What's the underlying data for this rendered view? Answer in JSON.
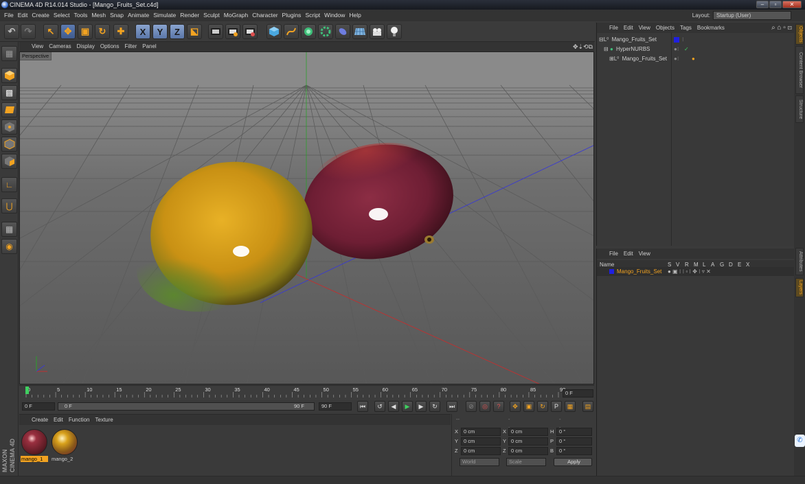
{
  "window": {
    "title": "CINEMA 4D R14.014 Studio - [Mango_Fruits_Set.c4d]",
    "min": "‒",
    "max": "▫",
    "close": "✕"
  },
  "menu": [
    "File",
    "Edit",
    "Create",
    "Select",
    "Tools",
    "Mesh",
    "Snap",
    "Animate",
    "Simulate",
    "Render",
    "Sculpt",
    "MoGraph",
    "Character",
    "Plugins",
    "Script",
    "Window",
    "Help"
  ],
  "layout": {
    "label": "Layout:",
    "value": "Startup (User)"
  },
  "toolbar": {
    "undo": "↶",
    "redo": "↷",
    "select": "↖",
    "move": "✥",
    "scale": "▣",
    "rotate": "↻",
    "add": "✚",
    "x": "X",
    "y": "Y",
    "z": "Z",
    "world": "⬕"
  },
  "viewport": {
    "menu": [
      "View",
      "Cameras",
      "Display",
      "Options",
      "Filter",
      "Panel"
    ],
    "label": "Perspective",
    "nav_icons": "✥⇣⟲⧉",
    "axis_label": "y x z"
  },
  "timeline": {
    "ticks": [
      "0",
      "5",
      "10",
      "15",
      "20",
      "25",
      "30",
      "35",
      "40",
      "45",
      "50",
      "55",
      "60",
      "65",
      "70",
      "75",
      "80",
      "85",
      "90"
    ],
    "end_field": "0 F"
  },
  "playback": {
    "start": "0 F",
    "slider_start": "0 F",
    "slider_end": "90 F",
    "end": "90 F"
  },
  "materials": {
    "menu": [
      "Create",
      "Edit",
      "Function",
      "Texture"
    ],
    "items": [
      {
        "name": "mango_1",
        "selected": true
      },
      {
        "name": "mango_2",
        "selected": false
      }
    ]
  },
  "coords": {
    "header": [
      "--",
      "--",
      "--"
    ],
    "rows": [
      {
        "a": "X",
        "av": "0 cm",
        "b": "X",
        "bv": "0 cm",
        "c": "H",
        "cv": "0 °"
      },
      {
        "a": "Y",
        "av": "0 cm",
        "b": "Y",
        "bv": "0 cm",
        "c": "P",
        "cv": "0 °"
      },
      {
        "a": "Z",
        "av": "0 cm",
        "b": "Z",
        "bv": "0 cm",
        "c": "B",
        "cv": "0 °"
      }
    ],
    "mode1": "World",
    "mode2": "Scale",
    "apply": "Apply"
  },
  "objects": {
    "menu": [
      "File",
      "Edit",
      "View",
      "Objects",
      "Tags",
      "Bookmarks"
    ],
    "rows": [
      {
        "name": "Mango_Fruits_Set",
        "indent": 0,
        "icon": "null-icon"
      },
      {
        "name": "HyperNURBS",
        "indent": 1,
        "icon": "hypernurbs-icon"
      },
      {
        "name": "Mango_Fruits_Set",
        "indent": 2,
        "icon": "null-icon"
      }
    ]
  },
  "layers": {
    "menu": [
      "File",
      "Edit",
      "View"
    ],
    "columns": [
      "Name",
      "S",
      "V",
      "R",
      "M",
      "L",
      "A",
      "G",
      "D",
      "E",
      "X"
    ],
    "rows": [
      {
        "name": "Mango_Fruits_Set",
        "color": "#2020e0"
      }
    ]
  },
  "sidetabs": [
    "Objects",
    "Content Browser",
    "Structure",
    "Attributes",
    "Layers"
  ],
  "branding": "MAXON CINEMA 4D",
  "colors": {
    "accent": "#f2a321",
    "layer": "#2020e0",
    "mango_yellow": "#d9a21c",
    "mango_red": "#7a2030"
  }
}
